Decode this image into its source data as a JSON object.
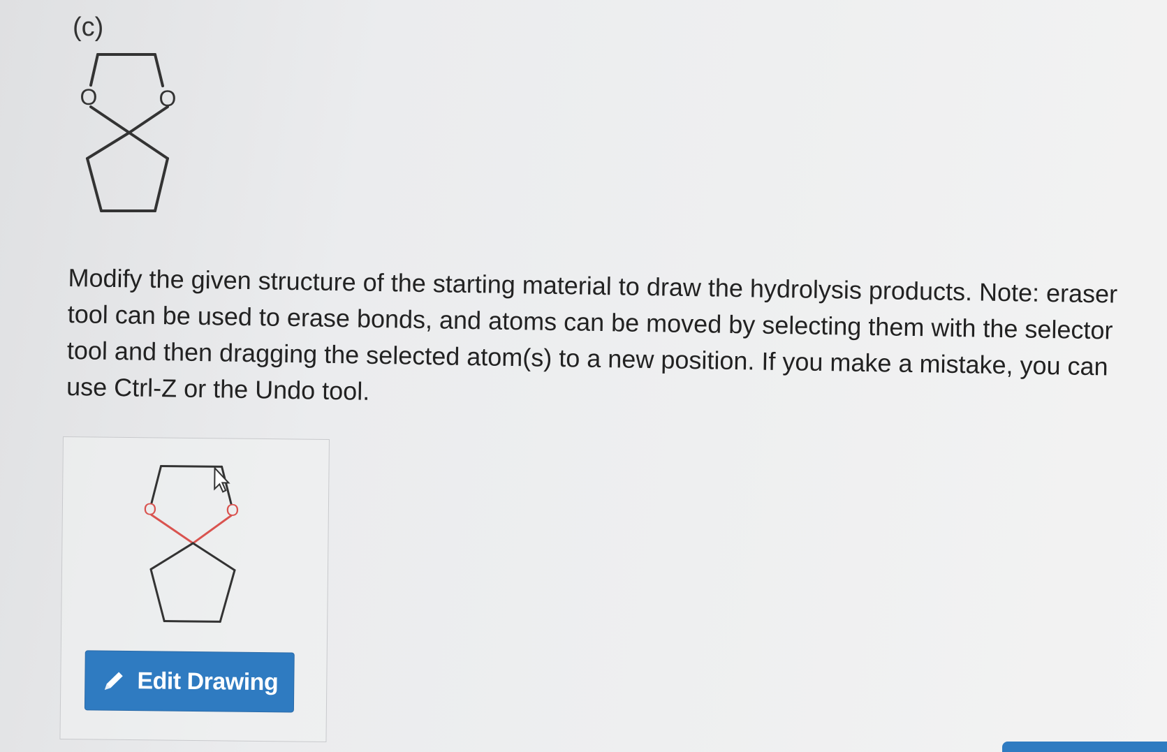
{
  "question": {
    "part_label": "(c)",
    "instructions": "Modify the given structure of the starting material to draw the hydrolysis products. Note: eraser tool can be used to erase bonds, and atoms can be moved by selecting them with the selector tool and then dragging the selected atom(s) to a new position. If you make a mistake, you can use Ctrl-Z or the Undo tool."
  },
  "given_structure": {
    "oxygen_left": "O",
    "oxygen_right": "O"
  },
  "drawing_panel": {
    "oxygen_left": "O",
    "oxygen_right": "O",
    "edit_button_label": "Edit Drawing",
    "edit_icon": "pencil-icon",
    "oxygen_color": "#d9534f",
    "button_color": "#2f7bc1"
  }
}
